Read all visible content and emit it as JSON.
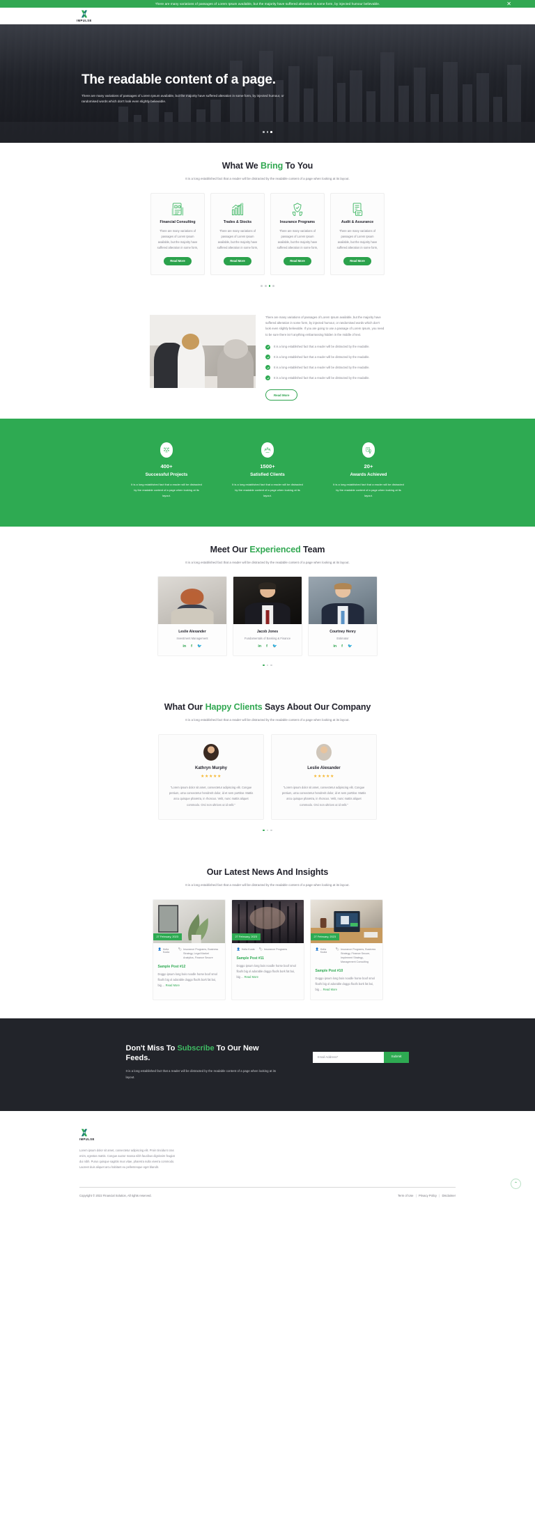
{
  "announcement": {
    "text": "There are many variations of passages of Lorem Ipsum available, but the majority have suffered alteration in some form, by injected humour believable.",
    "close_label": "✕"
  },
  "brand": {
    "name": "IMPULSE"
  },
  "hero": {
    "title": "The readable content of a page.",
    "subtitle": "There are many variations of passages of Lorem Ipsum available, but the majority have suffered alteration in some form, by injected humour, or randomised words which don't look even slightly believable.",
    "slide_count": 3,
    "active_slide": 3
  },
  "services": {
    "title_pre": "What We ",
    "title_hl": "Bring",
    "title_post": " To You",
    "subtitle": "It is a long established fact that a reader will be distracted by the readable content of a page when looking at its layout.",
    "cards": [
      {
        "title": "Financial Consulting",
        "text": "There are many variations of passages of Lorem Ipsum available, but the majority have suffered alteration in some form,",
        "button": "Read More",
        "icon": "document-chart-icon"
      },
      {
        "title": "Trades & Stocks",
        "text": "There are many variations of passages of Lorem Ipsum available, but the majority have suffered alteration in some form,",
        "button": "Read More",
        "icon": "growth-bar-icon"
      },
      {
        "title": "Insurance Programs",
        "text": "There are many variations of passages of Lorem Ipsum available, but the majority have suffered alteration in some form,",
        "button": "Read More",
        "icon": "shield-hands-icon"
      },
      {
        "title": "Audit & Assurance",
        "text": "There are many variations of passages of Lorem Ipsum available, but the majority have suffered alteration in some form,",
        "button": "Read More",
        "icon": "audit-report-icon"
      }
    ],
    "dot_count": 4,
    "active_dot": 3
  },
  "about": {
    "paragraph": "There are many variations of passages of Lorem Ipsum available, but the majority have suffered alteration in some form, by injected humour, or randomised words which don't look even slightly believable. If you are going to use a passage of Lorem Ipsum, you need to be sure there isn't anything embarrassing hidden in the middle of text.",
    "checks": [
      "It is a long established fact that a reader will be distracted by the readable.",
      "It is a long established fact that a reader will be distracted by the readable.",
      "It is a long established fact that a reader will be distracted by the readable.",
      "It is a long established fact that a reader will be distracted by the readable."
    ],
    "button": "Read More"
  },
  "stats": {
    "items": [
      {
        "number": "400+",
        "label": "Successful Projects",
        "text": "It is a long established fact that a reader will be distracted by the readable content of a page when looking at its layout.",
        "icon": "network-idea-icon"
      },
      {
        "number": "1500+",
        "label": "Satisfied Clients",
        "text": "It is a long established fact that a reader will be distracted by the readable content of a page when looking at its layout.",
        "icon": "people-group-icon"
      },
      {
        "number": "20+",
        "label": "Awards Achieved",
        "text": "It is a long established fact that a reader will be distracted by the readable content of a page when looking at its layout.",
        "icon": "award-badge-icon"
      }
    ]
  },
  "team": {
    "title_pre": "Meet Our ",
    "title_hl": "Experienced",
    "title_post": " Team",
    "subtitle": "It is a long established fact that a reader will be distracted by the readable content of a page when looking at its layout.",
    "members": [
      {
        "name": "Leslie Alexander",
        "role": "Investment Management"
      },
      {
        "name": "Jacob Jones",
        "role": "Fundamentals of Banking & Finance"
      },
      {
        "name": "Courtney Henry",
        "role": "Estimator"
      }
    ],
    "socials": [
      {
        "name": "linkedin-icon",
        "glyph": "in"
      },
      {
        "name": "facebook-icon",
        "glyph": "f"
      },
      {
        "name": "twitter-icon",
        "glyph": "🐦"
      }
    ],
    "dot_count": 3,
    "active_dot": 1
  },
  "testimonials": {
    "title_pre": "What Our ",
    "title_hl": "Happy Clients",
    "title_post": " Says About Our Company",
    "subtitle": "It is a long established fact that a reader will be distracted by the readable content of a page when looking at its layout.",
    "items": [
      {
        "name": "Kathryn Murphy",
        "stars": "★★★★★",
        "rating": 5,
        "quote": "\"Lorem ipsum dolor sit amet, consectetur adipiscing elit. Congue pretium, urna consectetur hendrerit dolor, id et sem porttitor. Mattis arcu quisque pharetra, in rhoncus. Velit, nunc mattis aliquet commodo. Orci non ultrices ut id velit.\""
      },
      {
        "name": "Leslie Alexander",
        "stars": "★★★★★",
        "rating": 5,
        "quote": "\"Lorem ipsum dolor sit amet, consectetur adipiscing elit. Congue pretium, urna consectetur hendrerit dolor, id et sem porttitor. Mattis arcu quisque pharetra, in rhoncus. Velit, nunc mattis aliquet commodo. Orci non ultrices ut id velit.\""
      }
    ],
    "dot_count": 3,
    "active_dot": 1
  },
  "blog": {
    "title": "Our Latest News And Insights",
    "subtitle": "It is a long established fact that a reader will be distracted by the readable content of a page when looking at its layout.",
    "posts": [
      {
        "date": "27 February, 2023",
        "author": "Holla Koala",
        "categories": "Insurance Programs, Business Strategy, Legal Market Analytics, Finance Secure",
        "title": "Sample Post #12",
        "excerpt": "Doggo ipsum long bois noodle horse boof smol floofs big ol adorable doggo floofs bork fat boi, big ...",
        "more": "Read More"
      },
      {
        "date": "27 February, 2023",
        "author": "Holla Koala",
        "categories": "Insurance Programs",
        "title": "Sample Post #11",
        "excerpt": "Doggo ipsum long bois noodle horse boof smol floofs big ol adorable doggo floofs bork fat boi, big ...",
        "more": "Read More"
      },
      {
        "date": "27 February, 2023",
        "author": "Holla Koala",
        "categories": "Insurance Programs, Business Strategy, Finance Secure, Implement Strategy, Management Consulting",
        "title": "Sample Post #10",
        "excerpt": "Doggo ipsum long bois noodle horse boof smol floofs big ol adorable doggo floofs bork fat boi, big ...",
        "more": "Read More"
      }
    ]
  },
  "newsletter": {
    "title_pre": "Don't Miss To ",
    "title_hl": "Subscribe",
    "title_post": " To Our New Feeds.",
    "text": "It is a long established fact that a reader will be distracted by the readable content of a page when looking at its layout.",
    "placeholder": "Email Address*",
    "submit": "Submit"
  },
  "footer": {
    "about": "Lorem ipsum dolor sit amet, consectetur adipiscing elit. Proin tincidunt cras enim, egestas mattis. Congue auctor massa nibh faucibus dignissim feugiat dui nibh. Purus quisque sagittis mus vitae, pharetra nulla viverra commodo. Laoreet duis aliquet arcu habitant eu pellentesque eget blandit.",
    "copyright": "Copyright © 2022 Financial Solution, All rights reserved.",
    "links": [
      "Term of Use",
      "Privacy Policy",
      "Disclaimer"
    ],
    "separator": "|",
    "to_top": "⌃"
  },
  "colors": {
    "accent": "#2eaa52",
    "accent_bright": "#3fbb63",
    "dark": "#22242a",
    "star": "#f5b731"
  }
}
